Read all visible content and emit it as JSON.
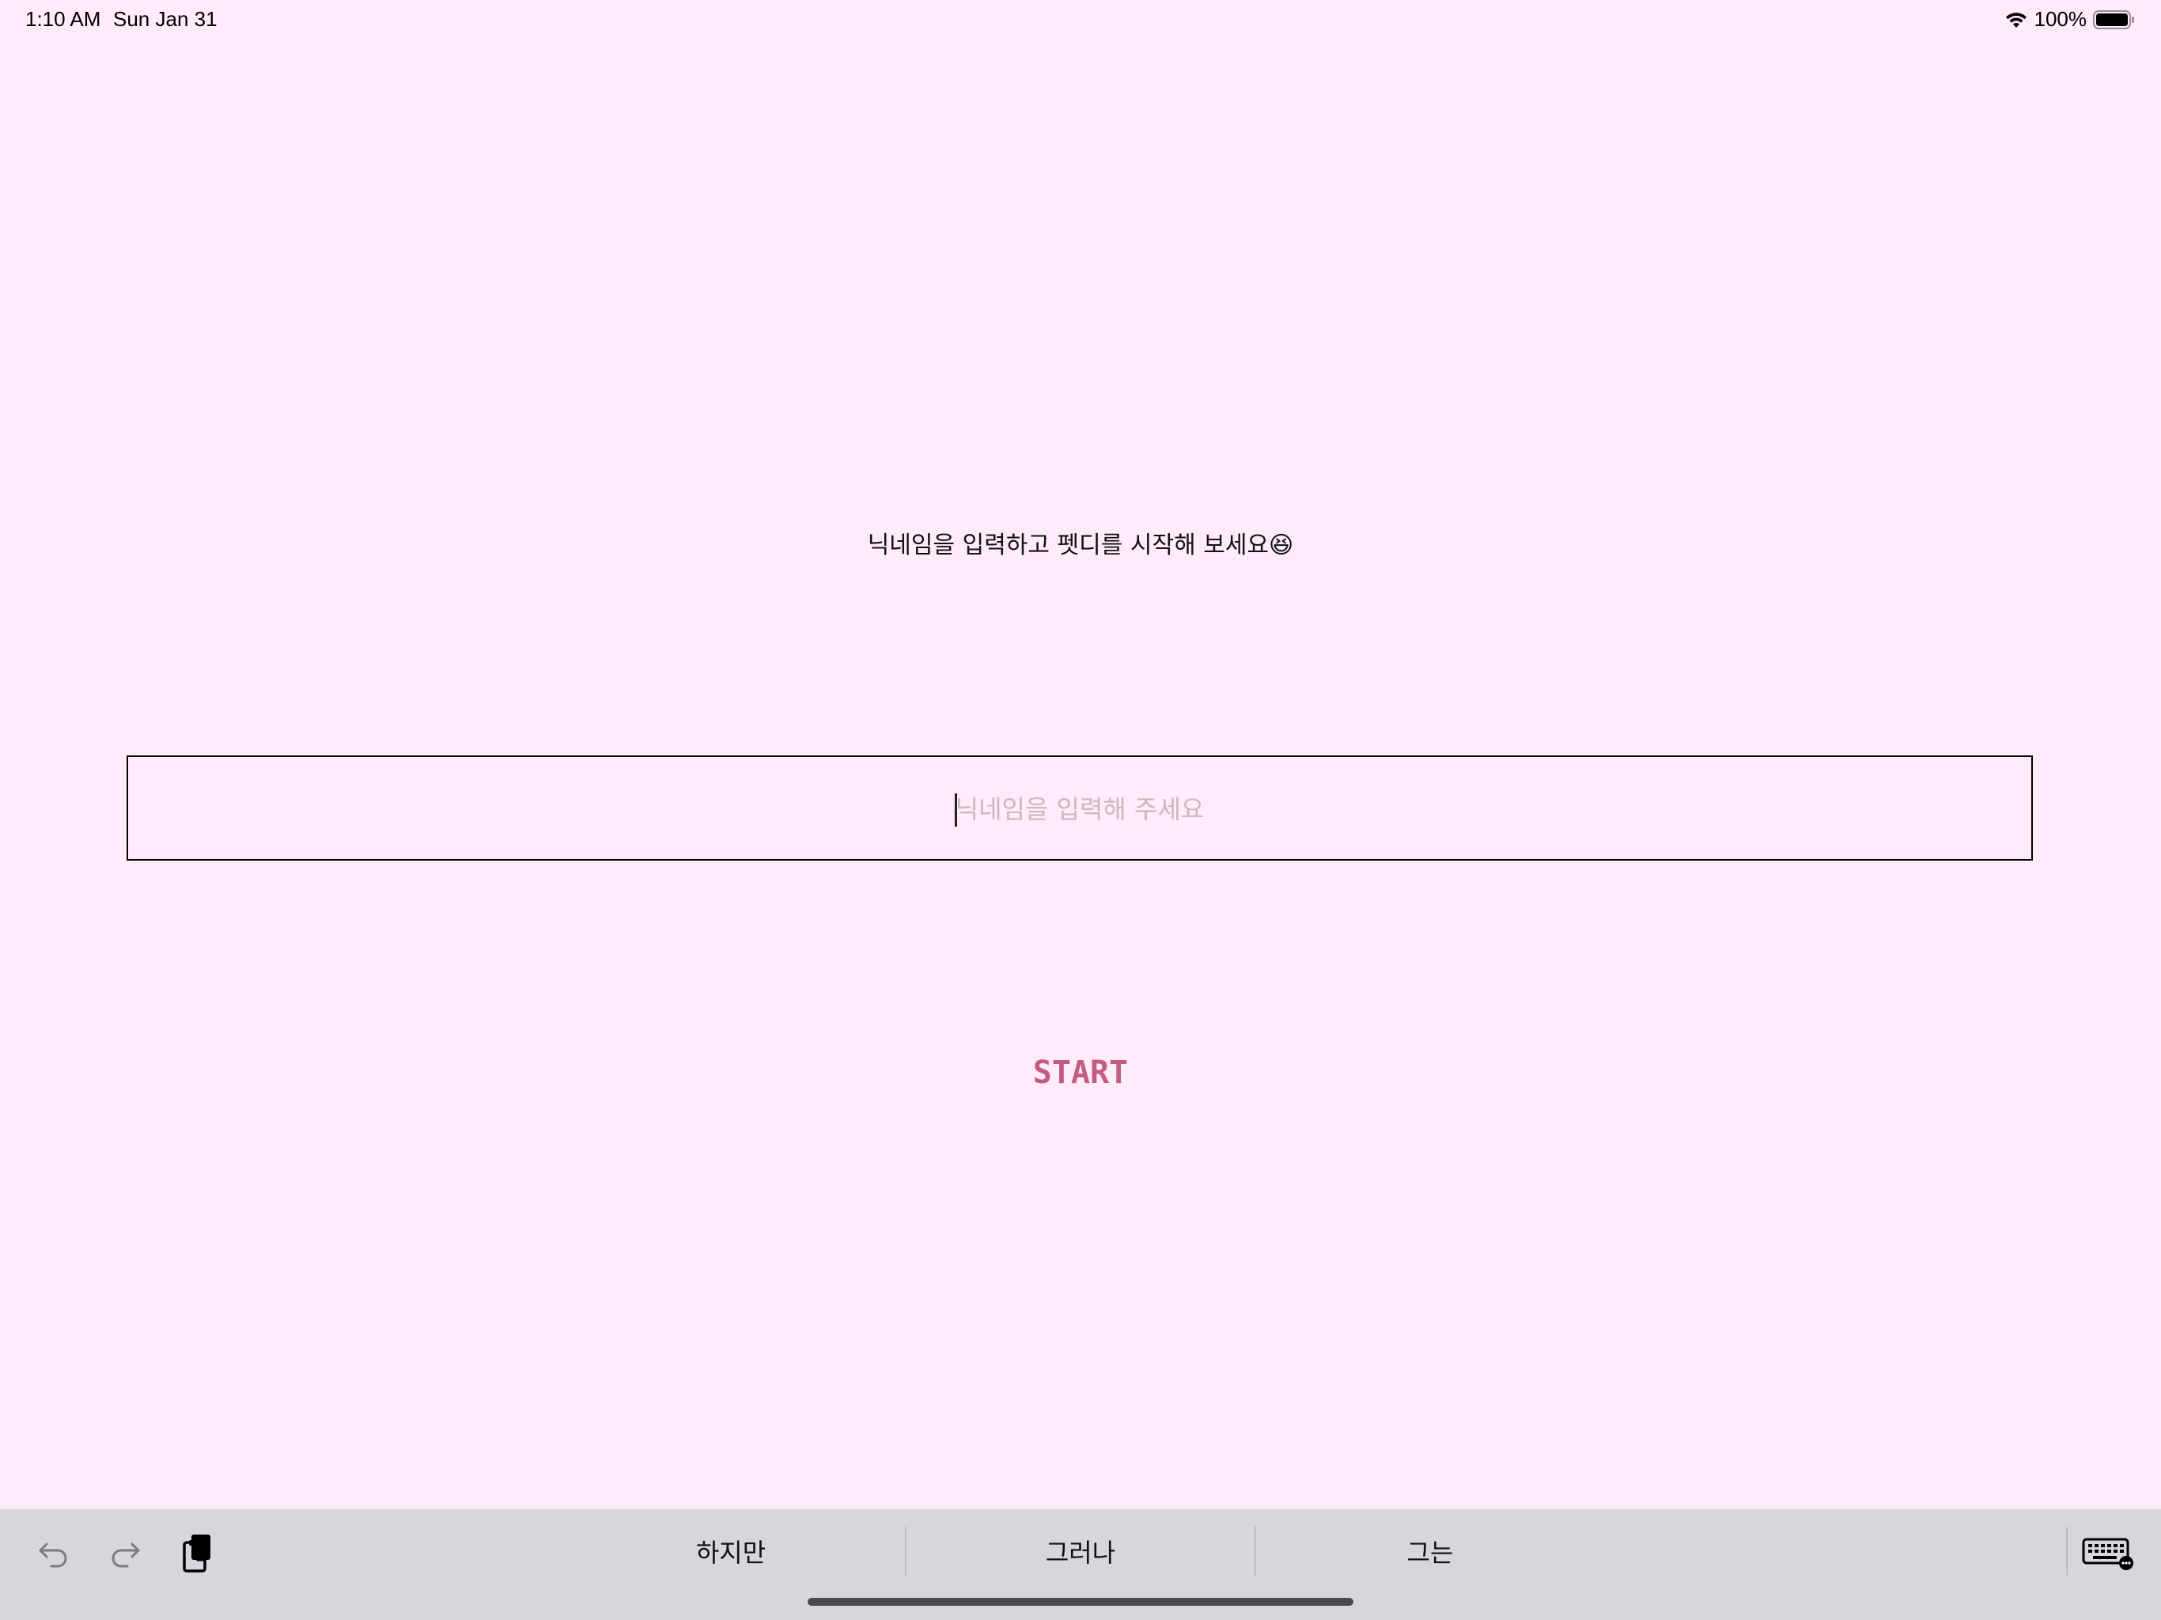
{
  "status_bar": {
    "time": "1:10 AM",
    "date": "Sun Jan 31",
    "battery_percent": "100%",
    "battery_level": 1.0
  },
  "main": {
    "headline": "닉네임을 입력하고 펫디를 시작해 보세요😆",
    "nickname_input": {
      "placeholder": "닉네임을 입력해 주세요",
      "value": ""
    },
    "start_label": "START"
  },
  "keyboard_bar": {
    "suggestions": [
      "하지만",
      "그러나",
      "그는"
    ],
    "icons": [
      "undo-icon",
      "redo-icon",
      "paste-icon",
      "keyboard-icon"
    ]
  },
  "colors": {
    "background": "#FFEBF9",
    "accent": "#C25D80",
    "placeholder": "#C5B9C2",
    "keyboard_bar": "#D6D6DC"
  }
}
